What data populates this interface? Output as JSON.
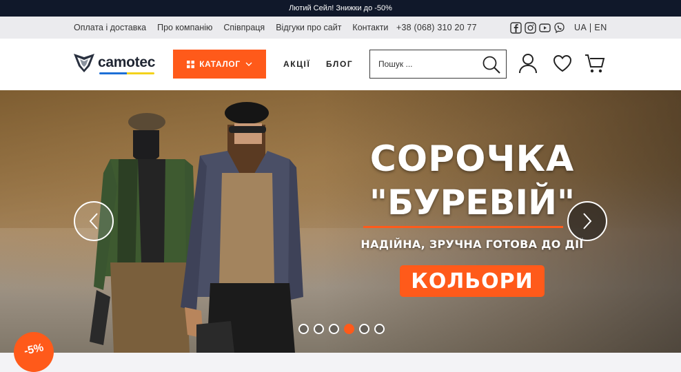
{
  "promo": {
    "text": "Лютий Сейл! Знижки до -50%"
  },
  "topnav": {
    "links": [
      "Оплата і доставка",
      "Про компанію",
      "Співпраця",
      "Відгуки про сайт",
      "Контакти"
    ],
    "phone": "+38 (068) 310 20 77",
    "socials": [
      "facebook-icon",
      "instagram-icon",
      "youtube-icon",
      "viber-icon"
    ],
    "lang": {
      "active": "UA",
      "other": "EN"
    }
  },
  "header": {
    "logo_text": "camotec",
    "catalog_label": "КАТАЛОГ",
    "nav": [
      "АКЦІЇ",
      "БЛОГ"
    ],
    "search_placeholder": "Пошук ..."
  },
  "hero": {
    "title_line1": "СОРОЧКА",
    "title_line2": "\"БУРЕВІЙ\"",
    "subtitle": "НАДІЙНА, ЗРУЧНА ГОТОВА ДО ДІЇ",
    "cta": "КОЛЬОРИ",
    "slides_count": 6,
    "active_slide": 4
  },
  "discount_badge": "-5%",
  "colors": {
    "accent": "#ff5a1a",
    "dark": "#10182a"
  }
}
